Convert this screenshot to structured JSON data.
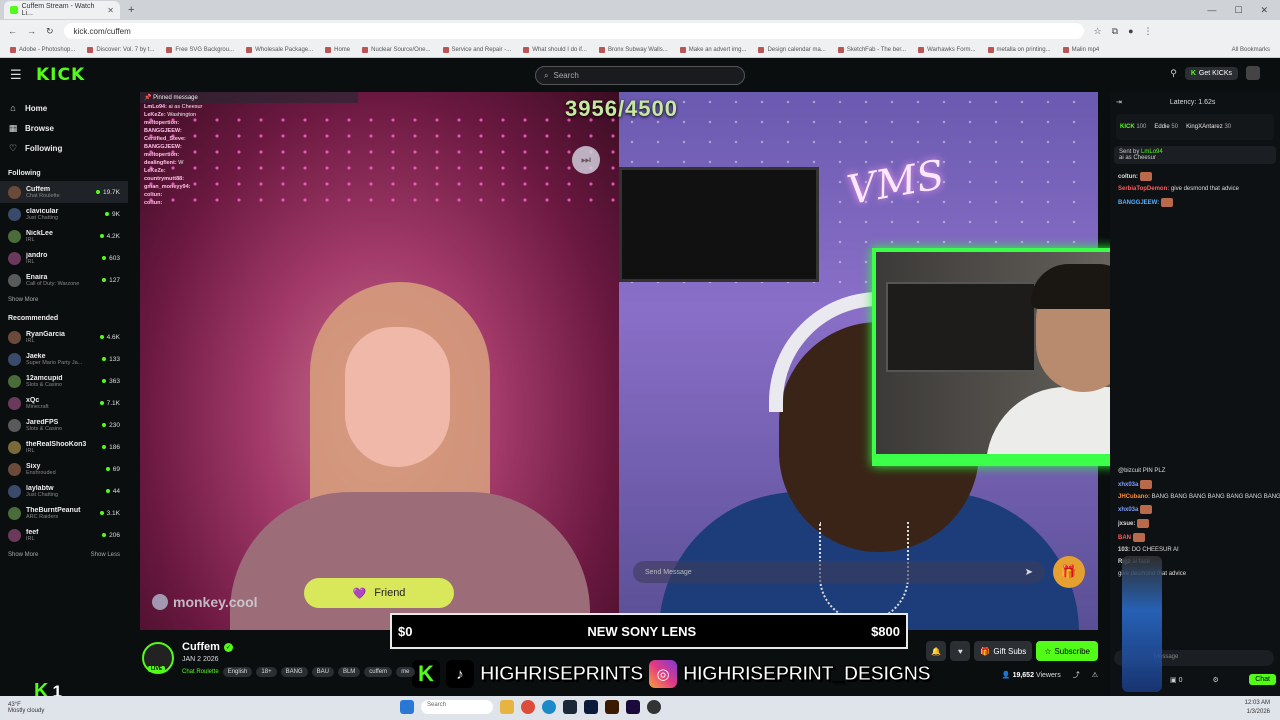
{
  "browser": {
    "tab_title": "Cuffem Stream - Watch Li...",
    "url": "kick.com/cuffem",
    "bookmarks": [
      "Adobe - Photoshop...",
      "Discover: Vol. 7 by t...",
      "Free SVG Backgrou...",
      "Wholesale Package...",
      "Home",
      "Nuclear Source/One...",
      "Service and Repair -...",
      "What should I do if...",
      "Bronx Subway Walls...",
      "Make an advert img...",
      "Design calendar ma...",
      "SketchFab - The ber...",
      "Warhawks Form...",
      "metalla on printing...",
      "Malin mp4"
    ],
    "all_bookmarks": "All Bookmarks"
  },
  "header": {
    "logo": "KICK",
    "search_placeholder": "Search",
    "get_kicks": "Get KICKs"
  },
  "sidebar": {
    "nav": [
      {
        "label": "Home",
        "icon": "home-icon"
      },
      {
        "label": "Browse",
        "icon": "browse-icon"
      },
      {
        "label": "Following",
        "icon": "heart-icon"
      }
    ],
    "following_title": "Following",
    "following": [
      {
        "name": "Cuffem",
        "category": "Chat Roulette",
        "viewers": "19.7K",
        "active": true
      },
      {
        "name": "clavicular",
        "category": "Just Chatting",
        "viewers": "9K"
      },
      {
        "name": "NickLee",
        "category": "IRL",
        "viewers": "4.2K"
      },
      {
        "name": "jandro",
        "category": "IRL",
        "viewers": "603"
      },
      {
        "name": "Enaira",
        "category": "Call of Duty: Warzone",
        "viewers": "127"
      }
    ],
    "show_more": "Show More",
    "recommended_title": "Recommended",
    "recommended": [
      {
        "name": "RyanGarcia",
        "category": "IRL",
        "viewers": "4.6K"
      },
      {
        "name": "Jaeke",
        "category": "Super Mario Party Ja...",
        "viewers": "133"
      },
      {
        "name": "12amcupid",
        "category": "Slots & Casino",
        "viewers": "363"
      },
      {
        "name": "xQc",
        "category": "Minecraft",
        "viewers": "7.1K"
      },
      {
        "name": "JaredFPS",
        "category": "Slots & Casino",
        "viewers": "230"
      },
      {
        "name": "theRealShooKon3",
        "category": "IRL",
        "viewers": "186"
      },
      {
        "name": "Sixy",
        "category": "Enshrouded",
        "viewers": "69"
      },
      {
        "name": "laylabtw",
        "category": "Just Chatting",
        "viewers": "44"
      },
      {
        "name": "TheBurntPeanut",
        "category": "ARC Raiders",
        "viewers": "3.1K"
      },
      {
        "name": "feef",
        "category": "IRL",
        "viewers": "206"
      }
    ],
    "show_more_2": "Show More",
    "show_less": "Show Less"
  },
  "video": {
    "counter": "3956/4500",
    "pinned_label": "Pinned message",
    "overlay_chat": [
      {
        "user": "LmLo94:",
        "text": "ai as Cheesur"
      },
      {
        "user": "LeKeZe:",
        "text": "Washington"
      },
      {
        "user": "meltopertion:",
        "text": ""
      },
      {
        "user": "BANGGJEEW:",
        "text": ""
      },
      {
        "user": "Certified_Steve:",
        "text": ""
      },
      {
        "user": "BANGGJEEW:",
        "text": ""
      },
      {
        "user": "meltopertion:",
        "text": ""
      },
      {
        "user": "dealingfient:",
        "text": "W"
      },
      {
        "user": "LeKeZe:",
        "text": ""
      },
      {
        "user": "countrymutt88:",
        "text": ""
      },
      {
        "user": "gman_moneyy94:",
        "text": ""
      },
      {
        "user": "coltun:",
        "text": ""
      },
      {
        "user": "coltun:",
        "text": ""
      }
    ],
    "watermark": "monkey.cool",
    "friend_button": "Friend",
    "send_placeholder": "Send Message",
    "banner_left": "$0",
    "banner_mid": "NEW SONY LENS",
    "banner_right": "$800",
    "social_1": "HIGHRISEPRINTS",
    "social_2": "HIGHRISEPRINT_DESIGNS",
    "neon_sign": "VMS"
  },
  "stream": {
    "name": "Cuffem",
    "date": "JAN 2 2026",
    "category": "Chat Roulette",
    "tags": [
      "English",
      "18+",
      "BANG",
      "BAU",
      "BLM",
      "cuffem",
      "me"
    ],
    "gift_subs": "Gift Subs",
    "subscribe": "Subscribe",
    "viewers": "19,652",
    "viewers_label": "Viewers",
    "live_badge": "LIVE"
  },
  "chat": {
    "latency": "Latency: 1.62s",
    "leaderboard": [
      {
        "name": "KICK",
        "score": "100"
      },
      {
        "name": "Eddie",
        "score": "50"
      },
      {
        "name": "KingXAntarez",
        "score": "30"
      }
    ],
    "pinned_by": "Sent by",
    "pinned_user": "LmLo94",
    "pinned_text": "ai as Cheesur",
    "messages_top": [
      {
        "user": "coltun:",
        "text": "",
        "color": "#ddd"
      },
      {
        "user": "SerbiaTopDemon:",
        "text": "give desmond that advice",
        "color": "#ff5a5a"
      },
      {
        "user": "BANGGJEEW:",
        "text": "",
        "color": "#5ab0ff"
      }
    ],
    "messages_bottom": [
      {
        "user": "",
        "text": "@bizcuit PIN PLZ",
        "color": "#ddd"
      },
      {
        "user": "xhx03a",
        "text": "",
        "color": "#7fa0ff"
      },
      {
        "user": "JHCubano:",
        "text": "BANG BANG BANG BANG BANG BANG BANG",
        "color": "#ff8a3a"
      },
      {
        "user": "xhx03a",
        "text": "",
        "color": "#7fa0ff"
      },
      {
        "user": "jxsue:",
        "text": "",
        "color": "#ddd"
      },
      {
        "user": "BAN",
        "text": "",
        "color": "#ff5a5a"
      },
      {
        "user": "103:",
        "text": "DO CHEESUR AI",
        "color": "#ddd"
      },
      {
        "user": "Rigz",
        "text": "ai face",
        "color": "#ddd"
      },
      {
        "user": "",
        "text": "give desmond that advice",
        "color": "#ddd"
      }
    ],
    "input_placeholder": "Message",
    "count": "0",
    "chat_button": "Chat"
  },
  "overlay": {
    "kick_counter": "1"
  },
  "taskbar": {
    "weather_line1": "43°F",
    "weather_line2": "Mostly cloudy",
    "search": "Search",
    "time": "12:03 AM",
    "date": "1/3/2026"
  },
  "colors": {
    "kick_green": "#53fc18",
    "pip_border": "#3cff4a"
  }
}
